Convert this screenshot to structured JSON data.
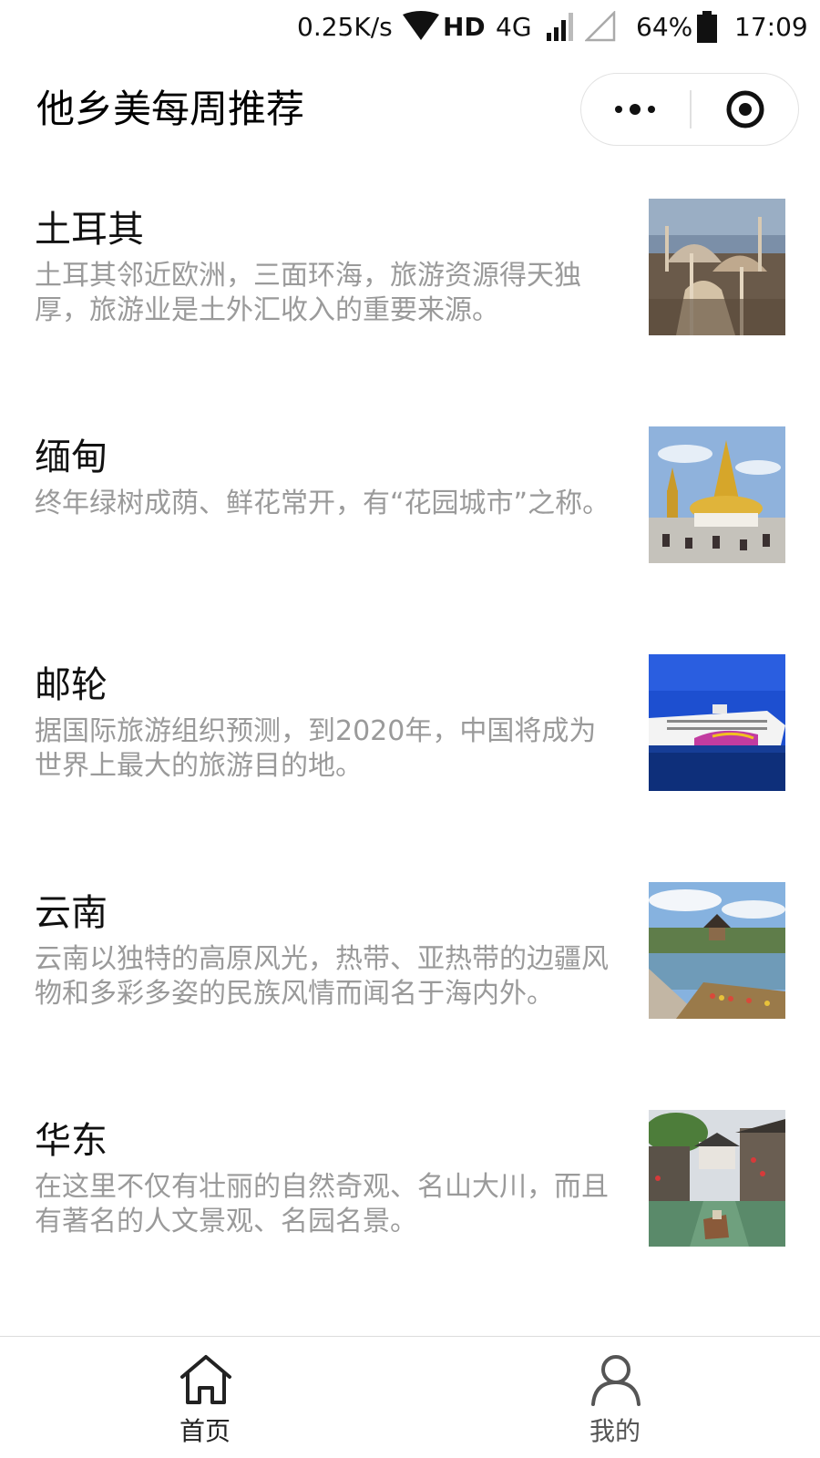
{
  "status_bar": {
    "net_speed": "0.25K/s",
    "hd": "HD",
    "network": "4G",
    "battery": "64%",
    "time": "17:09",
    "icons": [
      "wifi-icon",
      "signal-icon",
      "battery-icon"
    ]
  },
  "header": {
    "title": "他乡美每周推荐",
    "more_icon": "more-dots-icon",
    "close_icon": "target-circle-icon"
  },
  "list": [
    {
      "title": "土耳其",
      "desc": "土耳其邻近欧洲，三面环海，旅游资源得天独厚，旅游业是土外汇收入的重要来源。",
      "thumb": "turkey-mosque-photo"
    },
    {
      "title": "缅甸",
      "desc": "终年绿树成荫、鲜花常开，有“花园城市”之称。",
      "thumb": "myanmar-pagoda-photo"
    },
    {
      "title": "邮轮",
      "desc": "据国际旅游组织预测，到2020年，中国将成为世界上最大的旅游目的地。",
      "thumb": "cruise-ship-photo"
    },
    {
      "title": "云南",
      "desc": "云南以独特的高原风光，热带、亚热带的边疆风物和多彩多姿的民族风情而闻名于海内外。",
      "thumb": "yunnan-lake-photo"
    },
    {
      "title": "华东",
      "desc": "在这里不仅有壮丽的自然奇观、名山大川，而且有著名的人文景观、名园名景。",
      "thumb": "water-town-photo"
    }
  ],
  "tab_bar": {
    "tabs": [
      {
        "label": "首页",
        "icon": "home-icon",
        "active": true
      },
      {
        "label": "我的",
        "icon": "user-icon",
        "active": false
      }
    ]
  },
  "colors": {
    "title_text": "#111111",
    "desc_text": "#9a9a9a",
    "divider": "#dcdcdc"
  }
}
